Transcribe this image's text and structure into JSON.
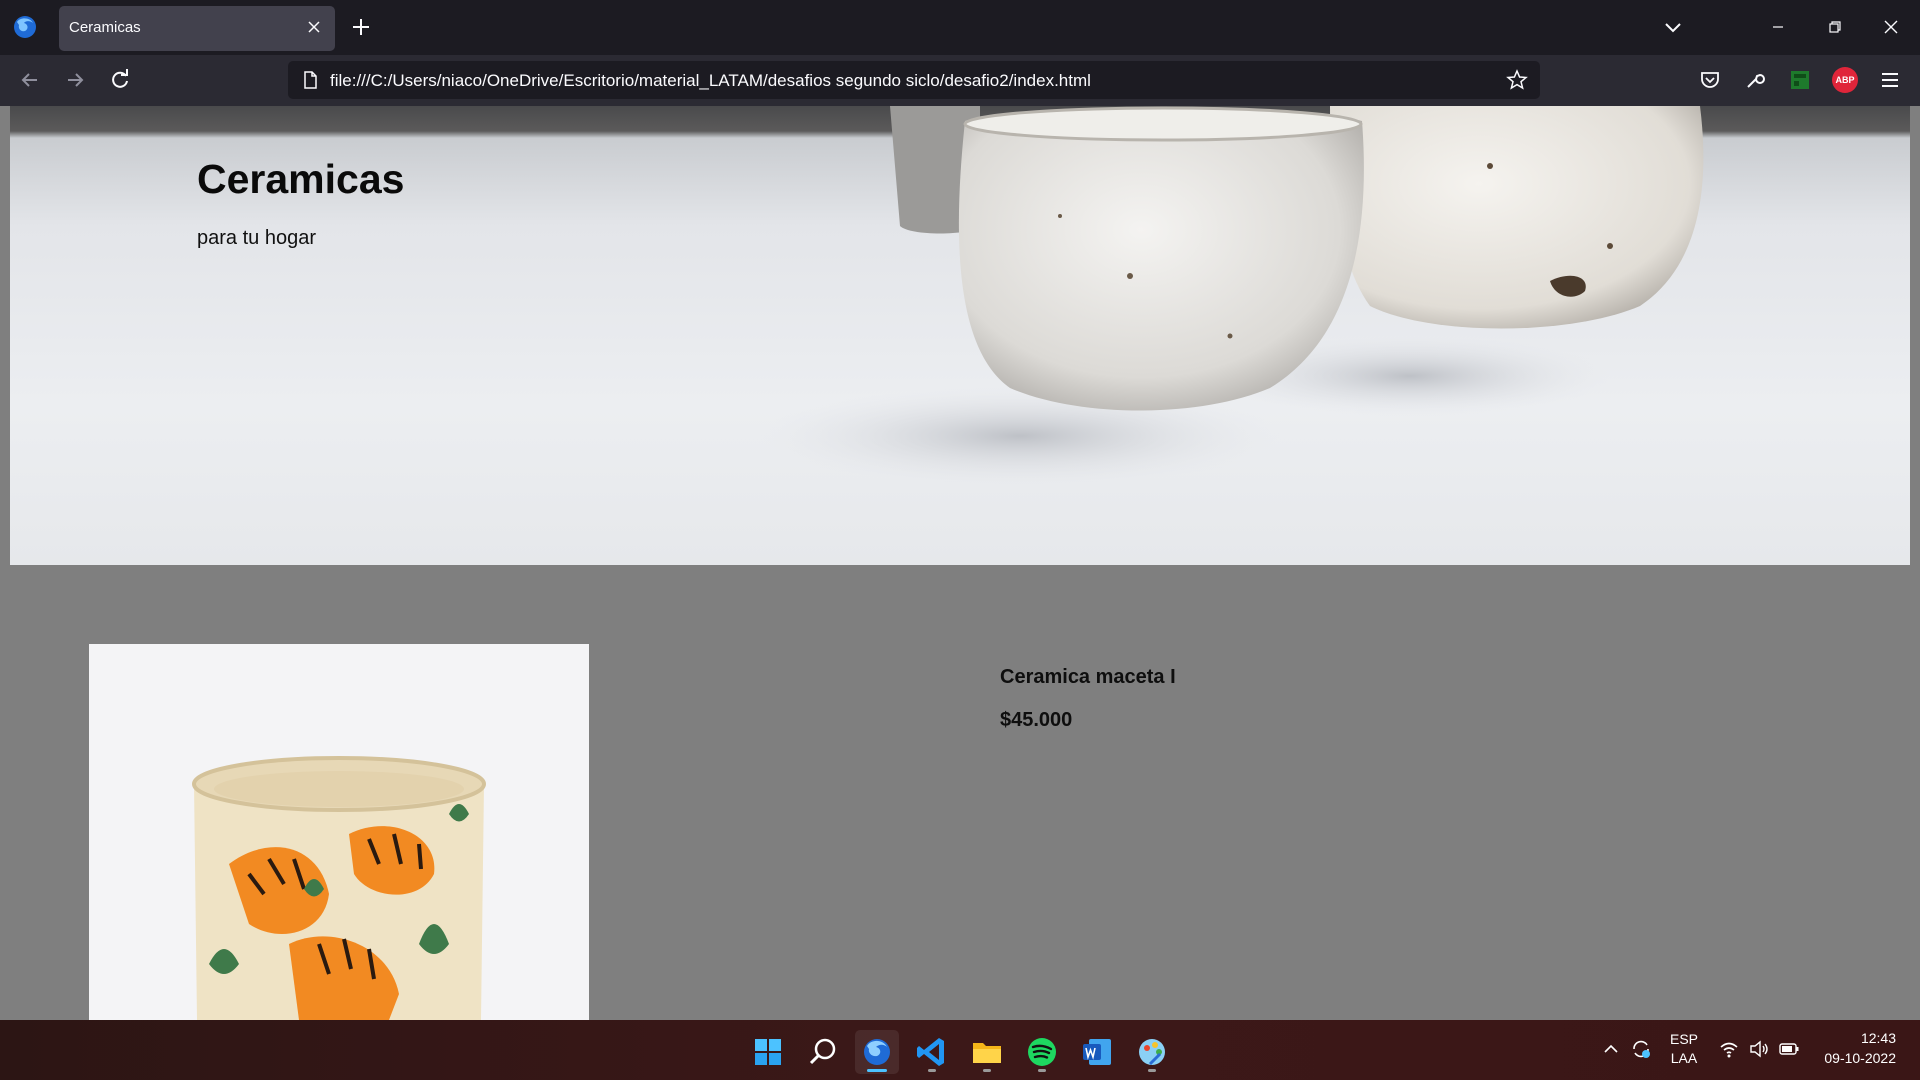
{
  "browser": {
    "tab_title": "Ceramicas",
    "url": "file:///C:/Users/niaco/OneDrive/Escritorio/material_LATAM/desafios segundo siclo/desafio2/index.html",
    "icons": [
      "firefox-icon",
      "tab-close-icon",
      "new-tab-icon",
      "tab-list-icon",
      "minimize-icon",
      "restore-icon",
      "close-window-icon",
      "back-icon",
      "forward-icon",
      "reload-icon",
      "page-icon",
      "bookmark-star-icon",
      "pocket-icon",
      "tools-icon",
      "extension-icon",
      "adblock-icon",
      "menu-icon"
    ],
    "adblock_label": "ABP"
  },
  "page": {
    "hero": {
      "title": "Ceramicas",
      "subtitle": "para tu hogar"
    },
    "product": {
      "name": "Ceramica maceta I",
      "price": "$45.000"
    }
  },
  "taskbar": {
    "apps": [
      "start",
      "search",
      "firefox",
      "vscode",
      "file-explorer",
      "spotify",
      "word",
      "paint"
    ],
    "language_top": "ESP",
    "language_bottom": "LAA",
    "time": "12:43",
    "date": "09-10-2022"
  }
}
